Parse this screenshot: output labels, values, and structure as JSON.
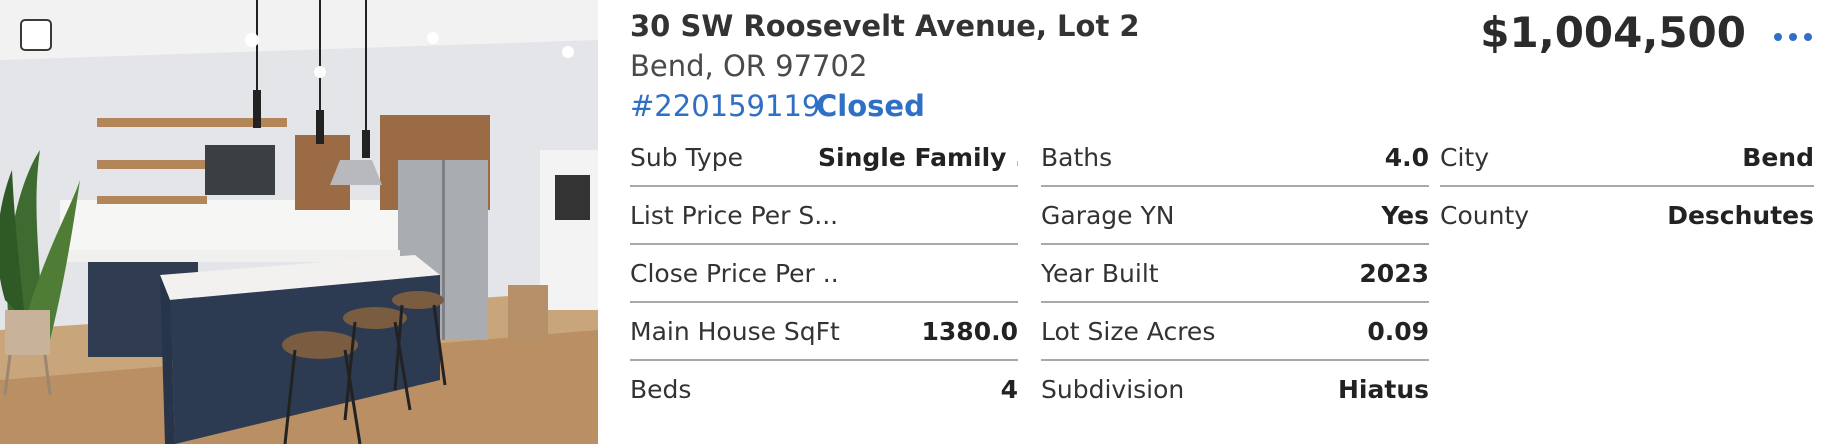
{
  "listing": {
    "address": "30 SW Roosevelt Avenue, Lot 2",
    "city_line": "Bend, OR 97702",
    "mls_number": "#220159119",
    "status": "Closed",
    "price": "$1,004,500",
    "more_icon": "more-horizontal-icon",
    "accent_color": "#2f6fc4"
  },
  "details": {
    "col1": [
      {
        "label": "Sub Type",
        "value": "Single Family ..."
      },
      {
        "label": "List Price Per S...",
        "value": ""
      },
      {
        "label": "Close Price Per ...",
        "value": ""
      },
      {
        "label": "Main House SqFt",
        "value": "1380.0"
      },
      {
        "label": "Beds",
        "value": "4"
      }
    ],
    "col2": [
      {
        "label": "Baths",
        "value": "4.0"
      },
      {
        "label": "Garage YN",
        "value": "Yes"
      },
      {
        "label": "Year Built",
        "value": "2023"
      },
      {
        "label": "Lot Size Acres",
        "value": "0.09"
      },
      {
        "label": "Subdivision",
        "value": "Hiatus"
      }
    ],
    "col3": [
      {
        "label": "City",
        "value": "Bend"
      },
      {
        "label": "County",
        "value": "Deschutes"
      }
    ]
  }
}
